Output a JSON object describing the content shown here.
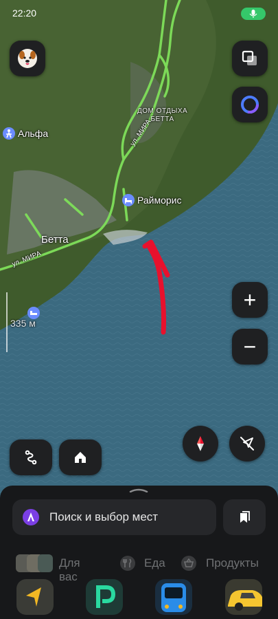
{
  "status_bar": {
    "time": "22:20"
  },
  "map": {
    "labels": {
      "rest_house_line1": "ДОМ ОТДЫХА",
      "rest_house_line2": "БЕТТА",
      "street_mira_north": "ул. МИРА",
      "street_mira_west": "ул. МИРА",
      "poi_alpha": "Альфа",
      "poi_raymoris": "Райморис",
      "settlement": "Бетта",
      "scale": "335 м"
    },
    "colors": {
      "sea": "#3b6a80",
      "land": "#3e5a2c",
      "road": "#7fe05a",
      "annotation": "#e8112d"
    }
  },
  "controls": {
    "layers_icon": "layers-icon",
    "alice_icon": "alice-icon",
    "zoom_in": "+",
    "zoom_out": "−",
    "compass_icon": "compass-icon",
    "location_icon": "location-off-icon",
    "route_icon": "route-icon",
    "home_icon": "home-icon"
  },
  "bottom_sheet": {
    "search_placeholder": "Поиск и выбор мест",
    "chips": [
      {
        "label": "Для вас",
        "icon": "avatars-icon"
      },
      {
        "label": "Еда",
        "icon": "fork-knife-icon"
      },
      {
        "label": "Продукты",
        "icon": "basket-icon"
      }
    ],
    "apps": [
      "navigator-app-icon",
      "parking-app-icon",
      "transport-app-icon",
      "taxi-app-icon"
    ]
  }
}
